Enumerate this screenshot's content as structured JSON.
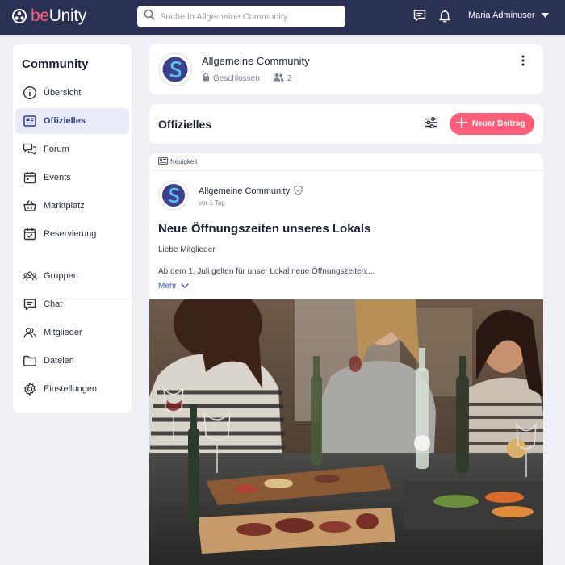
{
  "brand": {
    "part1": "be",
    "part2": "Unity"
  },
  "search": {
    "placeholder": "Suche in Allgemeine Community"
  },
  "user": {
    "name": "Maria Adminuser"
  },
  "topbar": {
    "icons": [
      "chat-icon",
      "bell-icon",
      "chevron-down-icon"
    ]
  },
  "sidebar": {
    "title": "Community",
    "items": [
      {
        "label": "Übersicht",
        "icon": "info-icon",
        "active": false
      },
      {
        "label": "Offizielles",
        "icon": "newspaper-icon",
        "active": true
      },
      {
        "label": "Forum",
        "icon": "forum-icon",
        "active": false
      },
      {
        "label": "Events",
        "icon": "calendar-icon",
        "active": false
      },
      {
        "label": "Marktplatz",
        "icon": "basket-icon",
        "active": false
      },
      {
        "label": "Reservierung",
        "icon": "calendar-check-icon",
        "active": false
      },
      {
        "label": "Gruppen",
        "icon": "groups-icon",
        "active": false
      },
      {
        "label": "Chat",
        "icon": "chat-icon",
        "active": false
      },
      {
        "label": "Mitglieder",
        "icon": "members-icon",
        "active": false
      },
      {
        "label": "Dateien",
        "icon": "folder-icon",
        "active": false
      },
      {
        "label": "Einstellungen",
        "icon": "gear-icon",
        "active": false
      }
    ]
  },
  "community": {
    "name": "Allgemeine Community",
    "visibility": "Geschlossen",
    "member_count": "2"
  },
  "section": {
    "title": "Offizielles",
    "new_post_label": "Neuer Beitrag"
  },
  "post": {
    "tag": "Neuigkeit",
    "author": "Allgemeine Community",
    "time": "vor 1 Tag",
    "title": "Neue Öffnungszeiten unseres Lokals",
    "paragraph1": "Liebe Mitglieder",
    "paragraph2": "Ab dem 1. Juli gelten für unser Lokal neue Öffnungszeiten:...",
    "more_label": "Mehr"
  },
  "colors": {
    "topbar": "#2b3154",
    "accent": "#ff5d78",
    "active_bg": "#e9ecf8",
    "active_text": "#2f3a8c",
    "link": "#3c5bd0"
  }
}
